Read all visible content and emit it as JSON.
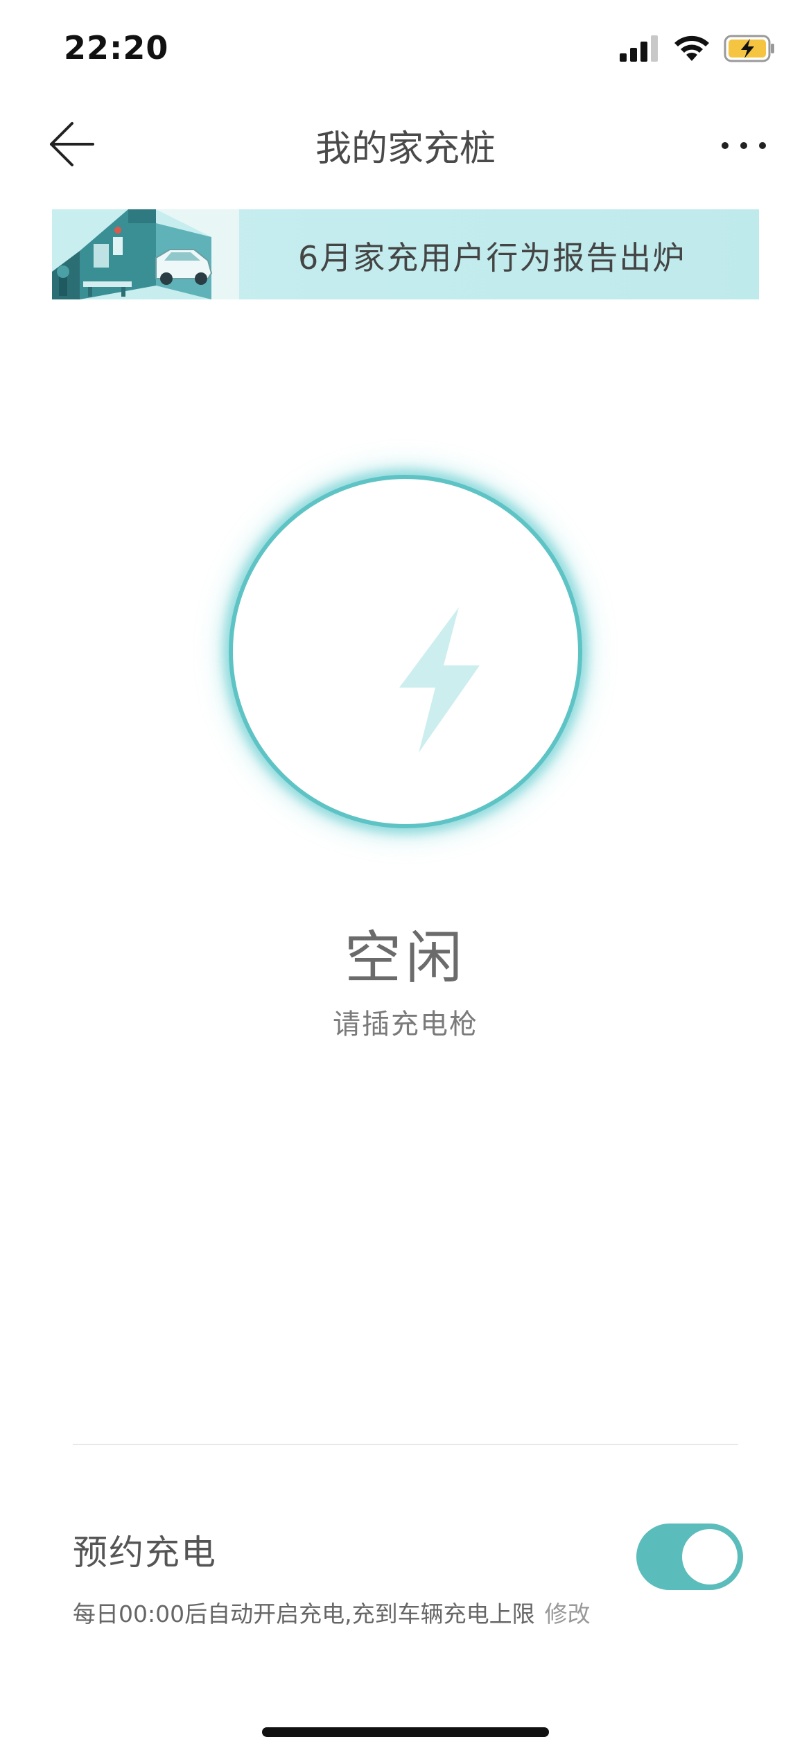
{
  "status_bar": {
    "time": "22:20",
    "icons": [
      "cellular-signal-icon",
      "wifi-icon",
      "battery-charging-icon"
    ],
    "battery_color": "#f5c542"
  },
  "nav": {
    "title": "我的家充桩",
    "back_icon": "arrow-left-icon",
    "more_icon": "more-dots-icon"
  },
  "banner": {
    "text": "6月家充用户行为报告出炉"
  },
  "charger": {
    "status": "空闲",
    "hint": "请插充电枪",
    "ring_color": "#5ec3c4",
    "icon": "lightning-bolt-icon"
  },
  "schedule": {
    "title": "预约充电",
    "description": "每日00:00后自动开启充电,充到车辆充电上限",
    "modify_label": "修改",
    "enabled": true,
    "toggle_color": "#5bbdbb"
  }
}
